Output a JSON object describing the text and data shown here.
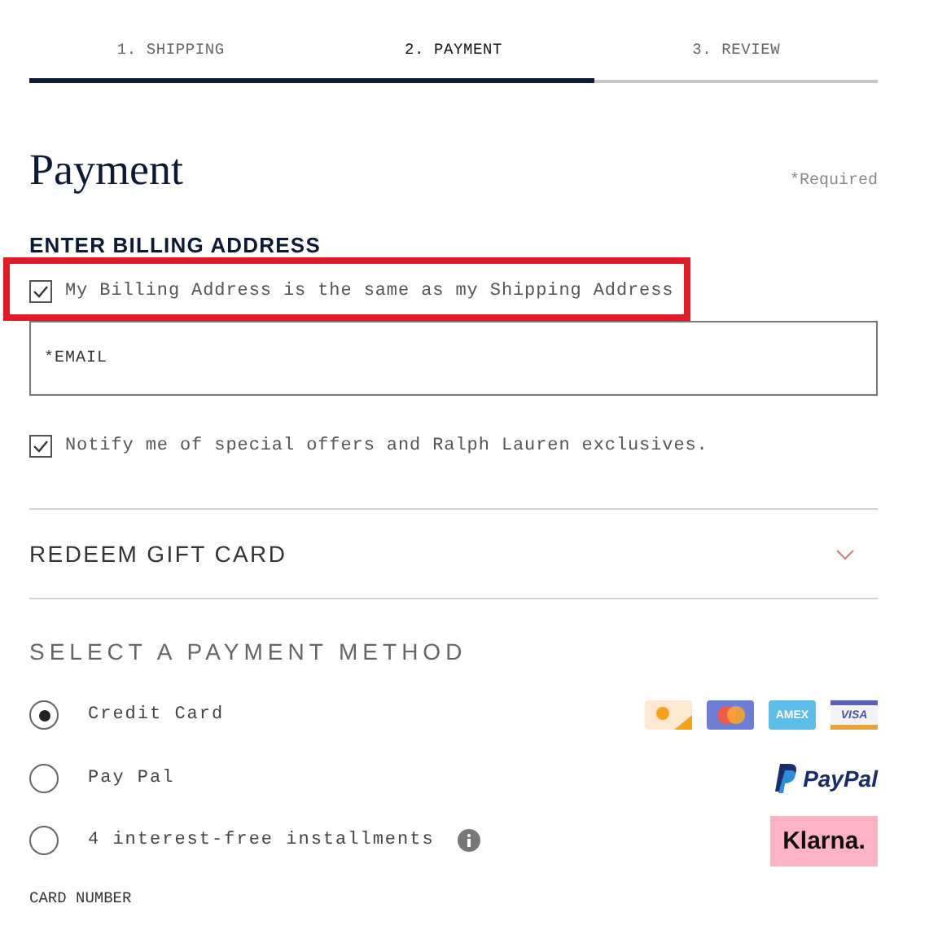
{
  "steps": [
    {
      "label": "1. SHIPPING",
      "selected": false
    },
    {
      "label": "2. PAYMENT",
      "selected": true
    },
    {
      "label": "3. REVIEW",
      "selected": false
    }
  ],
  "progress": {
    "level": 0.666
  },
  "title": "Payment",
  "required_note": "*Required",
  "billing": {
    "heading": "ENTER BILLING ADDRESS",
    "same_address": {
      "label": "My Billing Address is the same as my Shipping Address",
      "checked": true,
      "highlighted": true
    },
    "email": {
      "placeholder": "*EMAIL"
    },
    "notify": {
      "label": "Notify me of special offers and Ralph Lauren exclusives.",
      "checked": true
    }
  },
  "gift_card": {
    "label": "REDEEM GIFT CARD",
    "expanded": false
  },
  "payment": {
    "heading": "SELECT A PAYMENT METHOD",
    "methods": [
      {
        "label": "Credit Card",
        "selected": true,
        "info": false,
        "logos": [
          {
            "kind": "discover"
          },
          {
            "kind": "mastercard"
          },
          {
            "kind": "amex",
            "text": "AMEX"
          },
          {
            "kind": "visa",
            "text": "VISA"
          }
        ]
      },
      {
        "label": "Pay Pal",
        "selected": false,
        "info": false,
        "logos": [
          {
            "kind": "paypal",
            "text": "PayPal"
          }
        ]
      },
      {
        "label": "4 interest-free installments",
        "selected": false,
        "info": true,
        "logos": [
          {
            "kind": "klarna",
            "text": "Klarna."
          }
        ]
      }
    ]
  },
  "card_number_label": "CARD NUMBER"
}
